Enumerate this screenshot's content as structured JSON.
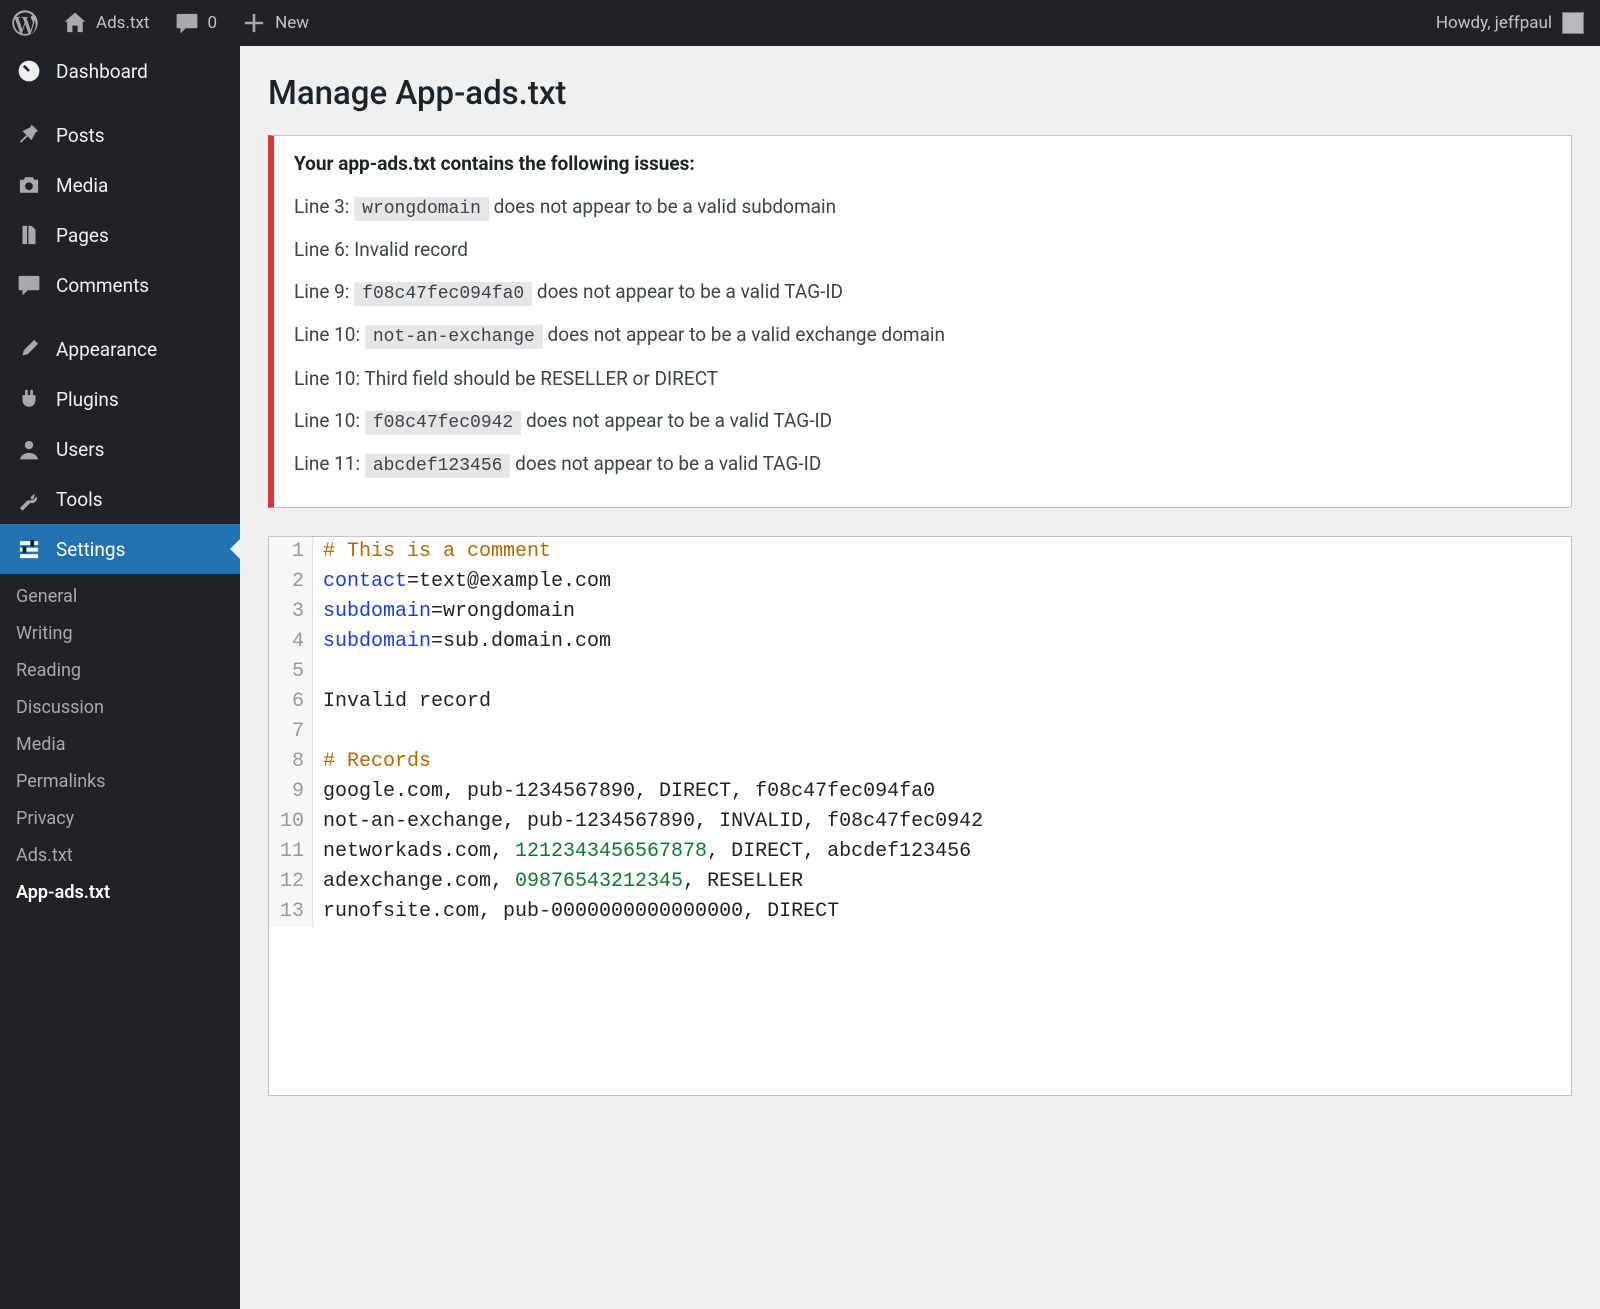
{
  "toolbar": {
    "site_name": "Ads.txt",
    "comments_count": "0",
    "new_label": "New",
    "howdy_prefix": "Howdy, ",
    "username": "jeffpaul"
  },
  "sidebar": {
    "items": [
      {
        "key": "dashboard",
        "label": "Dashboard",
        "icon": "dashboard"
      },
      {
        "key": "posts",
        "label": "Posts",
        "icon": "pin"
      },
      {
        "key": "media",
        "label": "Media",
        "icon": "camera"
      },
      {
        "key": "pages",
        "label": "Pages",
        "icon": "pages"
      },
      {
        "key": "comments",
        "label": "Comments",
        "icon": "comment"
      },
      {
        "key": "appearance",
        "label": "Appearance",
        "icon": "brush"
      },
      {
        "key": "plugins",
        "label": "Plugins",
        "icon": "plug"
      },
      {
        "key": "users",
        "label": "Users",
        "icon": "user"
      },
      {
        "key": "tools",
        "label": "Tools",
        "icon": "wrench"
      },
      {
        "key": "settings",
        "label": "Settings",
        "icon": "sliders",
        "active": true
      }
    ],
    "submenu": [
      {
        "label": "General"
      },
      {
        "label": "Writing"
      },
      {
        "label": "Reading"
      },
      {
        "label": "Discussion"
      },
      {
        "label": "Media"
      },
      {
        "label": "Permalinks"
      },
      {
        "label": "Privacy"
      },
      {
        "label": "Ads.txt"
      },
      {
        "label": "App-ads.txt",
        "current": true
      }
    ]
  },
  "page": {
    "title": "Manage App-ads.txt"
  },
  "notice": {
    "heading": "Your app-ads.txt contains the following issues:",
    "issues": [
      {
        "prefix": "Line 3: ",
        "code": "wrongdomain",
        "suffix": " does not appear to be a valid subdomain"
      },
      {
        "prefix": "Line 6: Invalid record",
        "code": "",
        "suffix": ""
      },
      {
        "prefix": "Line 9: ",
        "code": "f08c47fec094fa0",
        "suffix": " does not appear to be a valid TAG-ID"
      },
      {
        "prefix": "Line 10: ",
        "code": "not-an-exchange",
        "suffix": " does not appear to be a valid exchange domain"
      },
      {
        "prefix": "Line 10: Third field should be RESELLER or DIRECT",
        "code": "",
        "suffix": ""
      },
      {
        "prefix": "Line 10: ",
        "code": "f08c47fec0942",
        "suffix": " does not appear to be a valid TAG-ID"
      },
      {
        "prefix": "Line 11: ",
        "code": "abcdef123456",
        "suffix": " does not appear to be a valid TAG-ID"
      }
    ]
  },
  "editor": {
    "lines": [
      [
        {
          "t": "comment",
          "v": "# This is a comment"
        }
      ],
      [
        {
          "t": "key",
          "v": "contact"
        },
        {
          "t": "plain",
          "v": "=text@example.com"
        }
      ],
      [
        {
          "t": "key",
          "v": "subdomain"
        },
        {
          "t": "plain",
          "v": "=wrongdomain"
        }
      ],
      [
        {
          "t": "key",
          "v": "subdomain"
        },
        {
          "t": "plain",
          "v": "=sub.domain.com"
        }
      ],
      [
        {
          "t": "plain",
          "v": ""
        }
      ],
      [
        {
          "t": "plain",
          "v": "Invalid record"
        }
      ],
      [
        {
          "t": "plain",
          "v": ""
        }
      ],
      [
        {
          "t": "comment",
          "v": "# Records"
        }
      ],
      [
        {
          "t": "plain",
          "v": "google.com, pub-1234567890, DIRECT, f08c47fec094fa0"
        }
      ],
      [
        {
          "t": "plain",
          "v": "not-an-exchange, pub-1234567890, INVALID, f08c47fec0942"
        }
      ],
      [
        {
          "t": "plain",
          "v": "networkads.com, "
        },
        {
          "t": "num",
          "v": "1212343456567878"
        },
        {
          "t": "plain",
          "v": ", DIRECT, abcdef123456"
        }
      ],
      [
        {
          "t": "plain",
          "v": "adexchange.com, "
        },
        {
          "t": "num",
          "v": "09876543212345"
        },
        {
          "t": "plain",
          "v": ", RESELLER"
        }
      ],
      [
        {
          "t": "plain",
          "v": "runofsite.com, pub-0000000000000000, DIRECT"
        }
      ]
    ]
  }
}
